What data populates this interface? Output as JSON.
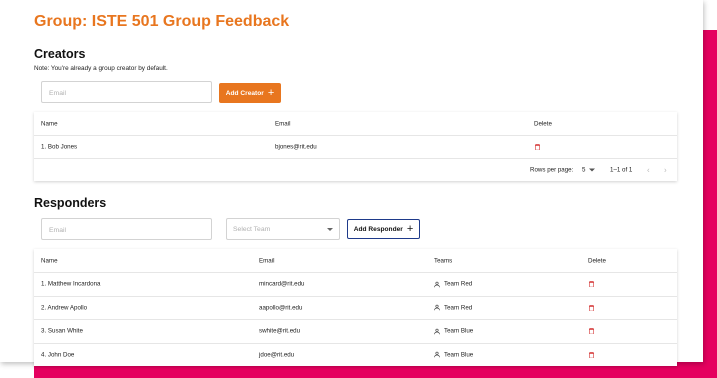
{
  "page": {
    "title": "Group: ISTE 501 Group Feedback"
  },
  "creators": {
    "heading": "Creators",
    "note": "Note: You're already a group creator by default.",
    "email_placeholder": "Email",
    "add_button": "Add Creator",
    "columns": {
      "name": "Name",
      "email": "Email",
      "delete": "Delete"
    },
    "rows": [
      {
        "name": "1. Bob Jones",
        "email": "bjones@rit.edu"
      }
    ],
    "pagination": {
      "rows_per_page_label": "Rows per page:",
      "rows_per_page": "5",
      "range": "1–1 of 1"
    }
  },
  "responders": {
    "heading": "Responders",
    "email_placeholder": "Email",
    "team_placeholder": "Select Team",
    "add_button": "Add Responder",
    "columns": {
      "name": "Name",
      "email": "Email",
      "teams": "Teams",
      "delete": "Delete"
    },
    "rows": [
      {
        "name": "1. Matthew Incardona",
        "email": "mincard@rit.edu",
        "team": "Team Red"
      },
      {
        "name": "2. Andrew Apollo",
        "email": "aapollo@rit.edu",
        "team": "Team Red"
      },
      {
        "name": "3. Susan White",
        "email": "swhite@rit.edu",
        "team": "Team Blue"
      },
      {
        "name": "4. John Doe",
        "email": "jdoe@rit.edu",
        "team": "Team Blue"
      }
    ]
  },
  "colors": {
    "accent": "#e8761f",
    "backdrop": "#e5005f",
    "delete": "#d32f2f",
    "outline": "#1e3a8a"
  },
  "icons": {
    "add": "plus-icon",
    "delete": "trash-icon",
    "team": "person-icon",
    "dropdown": "chevron-down-icon",
    "prev": "chevron-left-icon",
    "next": "chevron-right-icon"
  }
}
